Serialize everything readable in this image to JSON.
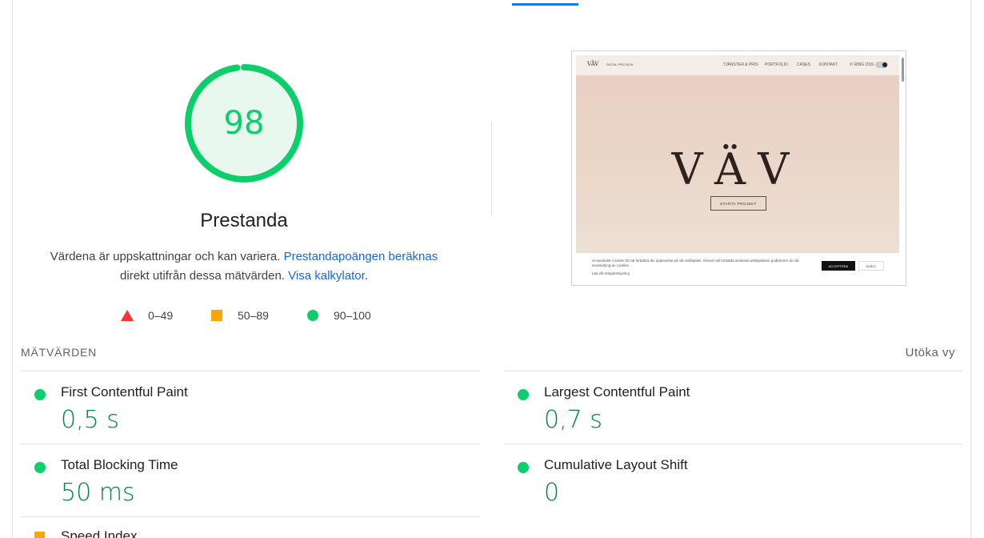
{
  "gauge": {
    "score": "98",
    "value": 98,
    "color": "#0cce6b"
  },
  "category": {
    "title": "Prestanda"
  },
  "description": {
    "text1": "Värdena är uppskattningar och kan variera.",
    "link1": "Prestandapoängen beräknas",
    "text2": "direkt utifrån dessa mätvärden.",
    "link2": "Visa kalkylator",
    "text3": "."
  },
  "legend": [
    {
      "label": "0–49",
      "icon": "red-triangle-icon",
      "color": "#ff3333"
    },
    {
      "label": "50–89",
      "icon": "orange-square-icon",
      "color": "#ffa400"
    },
    {
      "label": "90–100",
      "icon": "green-circle-icon",
      "color": "#0cce6b"
    }
  ],
  "screenshot": {
    "nav_logo": "VÄV",
    "nav_tagline": "DIGITAL PRECISION",
    "nav_items": [
      "TJÄNSTER & PRIS",
      "PORTFOLIO",
      "CASES",
      "KONTAKT",
      "RING OSS"
    ],
    "hero_title": "VÄV",
    "hero_button": "STARTA PROJEKT",
    "cookie_text": "Vi använder cookies för att förbättra din upplevelse på vår webbplats. Genom att fortsätta använda webbplatsen godkänner du vår användning av cookies.",
    "cookie_link": "Läs vår integritetspolicy.",
    "accept_button": "ACCEPTERA",
    "decline_button": "AVBÖJ"
  },
  "metrics_section": {
    "label": "MÄTVÄRDEN",
    "expand_link": "Utöka vy"
  },
  "metrics": [
    {
      "name": "First Contentful Paint",
      "value": "0,5 s",
      "status": "good"
    },
    {
      "name": "Largest Contentful Paint",
      "value": "0,7 s",
      "status": "good"
    },
    {
      "name": "Total Blocking Time",
      "value": "50 ms",
      "status": "good"
    },
    {
      "name": "Cumulative Layout Shift",
      "value": "0",
      "status": "good"
    },
    {
      "name": "Speed Index",
      "value": "",
      "status": "average"
    }
  ]
}
